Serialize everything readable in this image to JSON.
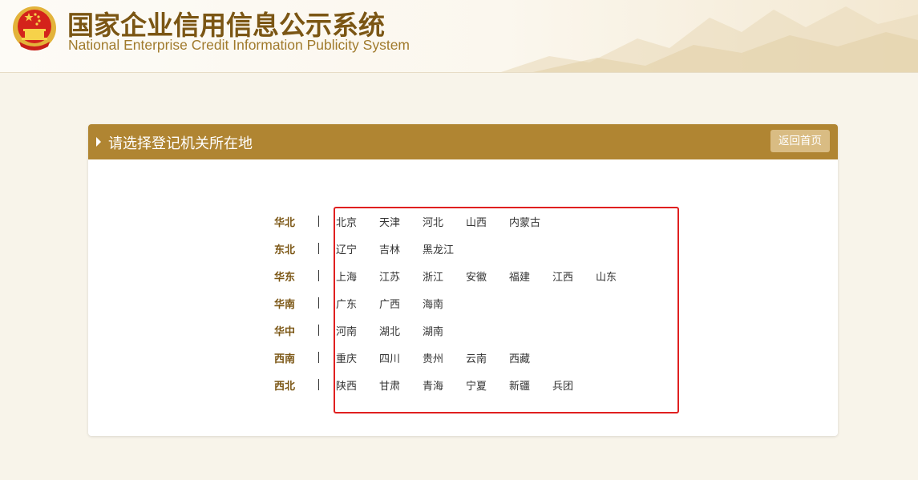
{
  "header": {
    "title_cn": "国家企业信用信息公示系统",
    "title_en": "National Enterprise Credit Information Publicity System"
  },
  "panel": {
    "title": "请选择登记机关所在地",
    "back_button": "返回首页"
  },
  "regions": [
    {
      "name": "华北",
      "provinces": [
        "北京",
        "天津",
        "河北",
        "山西",
        "内蒙古"
      ]
    },
    {
      "name": "东北",
      "provinces": [
        "辽宁",
        "吉林",
        "黑龙江"
      ]
    },
    {
      "name": "华东",
      "provinces": [
        "上海",
        "江苏",
        "浙江",
        "安徽",
        "福建",
        "江西",
        "山东"
      ]
    },
    {
      "name": "华南",
      "provinces": [
        "广东",
        "广西",
        "海南"
      ]
    },
    {
      "name": "华中",
      "provinces": [
        "河南",
        "湖北",
        "湖南"
      ]
    },
    {
      "name": "西南",
      "provinces": [
        "重庆",
        "四川",
        "贵州",
        "云南",
        "西藏"
      ]
    },
    {
      "name": "西北",
      "provinces": [
        "陕西",
        "甘肃",
        "青海",
        "宁夏",
        "新疆",
        "兵团"
      ]
    }
  ],
  "colors": {
    "accent": "#b08532",
    "title": "#7b5614",
    "highlight": "#e02020"
  }
}
